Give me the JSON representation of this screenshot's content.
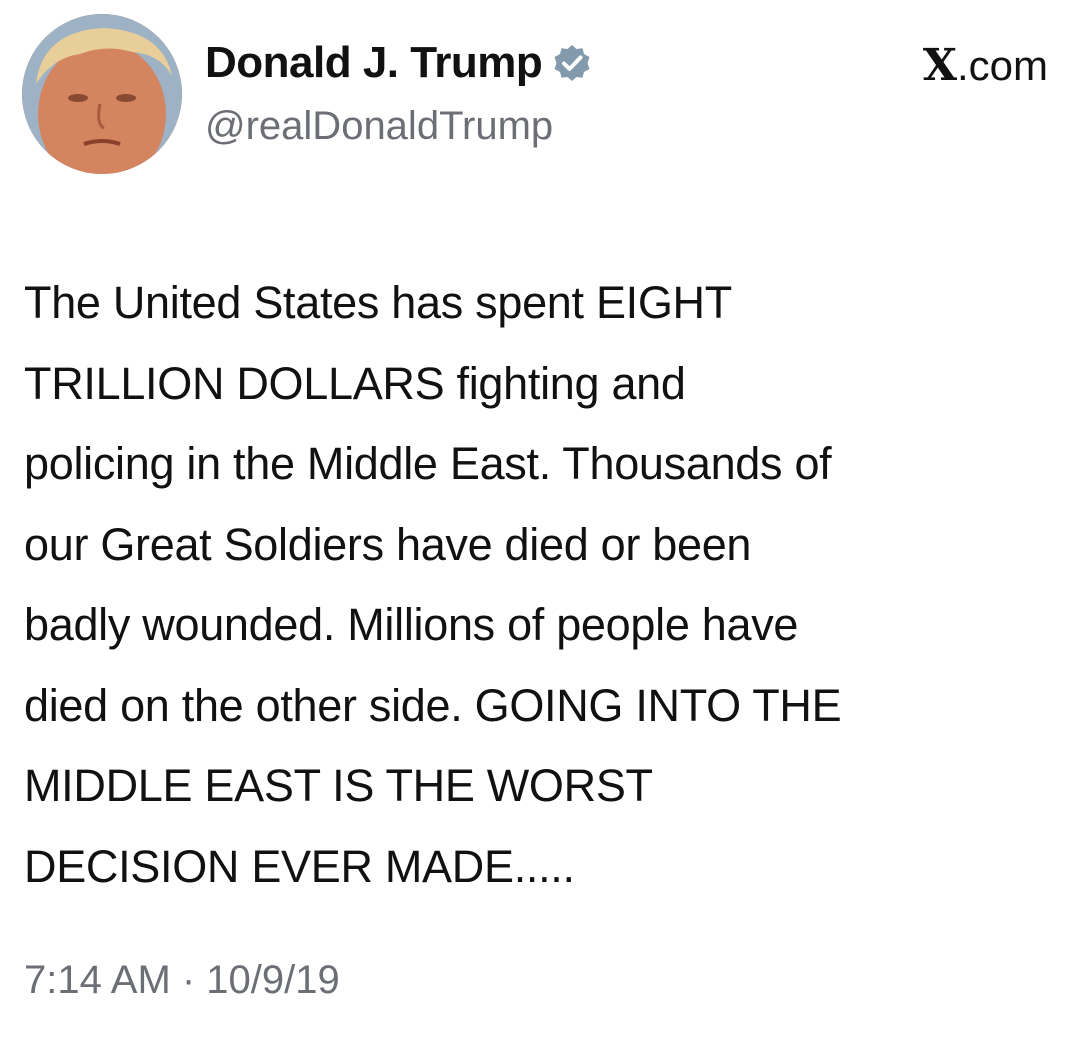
{
  "tweet": {
    "author": {
      "display_name": "Donald J. Trump",
      "handle": "@realDonaldTrump",
      "verified": true,
      "avatar_icon": "profile-photo",
      "verified_icon": "verified-badge-icon",
      "verified_color": "#829aab"
    },
    "source": {
      "x_mark": "X",
      "domain_suffix": ".com"
    },
    "body_lines": [
      "The United States has spent EIGHT",
      "TRILLION DOLLARS fighting and",
      "policing in the Middle East. Thousands of",
      "our Great Soldiers have died or been",
      "badly wounded. Millions of people have",
      "died on the other side. GOING INTO THE",
      "MIDDLE EAST IS THE WORST",
      "DECISION EVER MADE....."
    ],
    "timestamp": "7:14 AM · 10/9/19"
  },
  "colors": {
    "text": "#111111",
    "secondary_text": "#6b6f75",
    "background": "#ffffff"
  }
}
